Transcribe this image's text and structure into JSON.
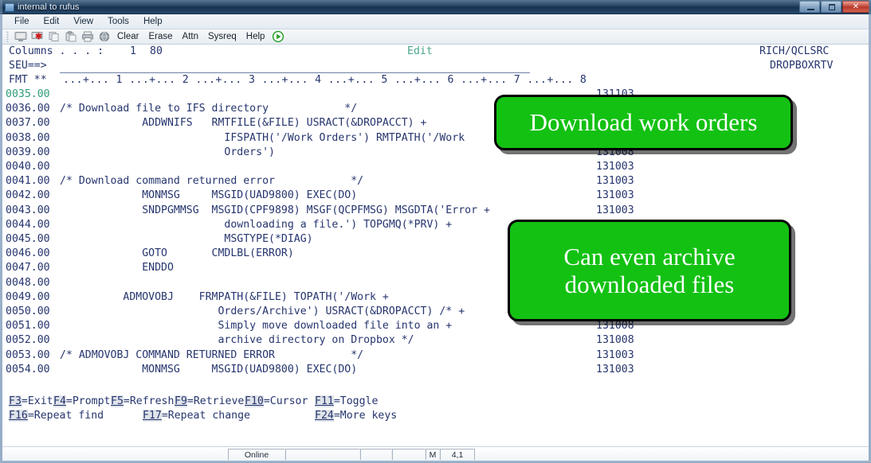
{
  "window": {
    "title": "internal to rufus",
    "buttons": {
      "minimize": "minimize-button",
      "maximize": "maximize-button",
      "close": "close-button"
    }
  },
  "menubar": {
    "items": [
      "File",
      "Edit",
      "View",
      "Tools",
      "Help"
    ]
  },
  "toolbar": {
    "icons": [
      "display-icon",
      "disconnect-icon",
      "copy-icon",
      "paste-icon",
      "print-icon",
      "macro-icon"
    ],
    "words": [
      "Clear",
      "Erase",
      "Attn",
      "Sysreq",
      "Help"
    ],
    "play": "play-icon"
  },
  "terminal": {
    "header": {
      "columns_label": "Columns . . . :",
      "columns_from": "1",
      "columns_to": "80",
      "mode": "Edit",
      "library": "RICH/QCLSRC",
      "member": "DROPBOXRTV",
      "seu_label": "SEU==>",
      "seu_value": "",
      "fmt_label": "FMT **",
      "ruler": "...+... 1 ...+... 2 ...+... 3 ...+... 4 ...+... 5 ...+... 6 ...+... 7 ...+... 8"
    },
    "lines": [
      {
        "num": "0035.00",
        "text": "",
        "date": "131103",
        "current": true
      },
      {
        "num": "0036.00",
        "text": "/* Download file to IFS directory            */",
        "date": "",
        "current": false
      },
      {
        "num": "0037.00",
        "text": "             ADDWNIFS   RMTFILE(&FILE) USRACT(&DROPACCT) +",
        "date": "",
        "current": false
      },
      {
        "num": "0038.00",
        "text": "                          IFSPATH('/Work Orders') RMTPATH('/Work",
        "date": "",
        "current": false
      },
      {
        "num": "0039.00",
        "text": "                          Orders')",
        "date": "131008",
        "current": false
      },
      {
        "num": "0040.00",
        "text": "",
        "date": "131003",
        "current": false
      },
      {
        "num": "0041.00",
        "text": "/* Download command returned error            */",
        "date": "131003",
        "current": false
      },
      {
        "num": "0042.00",
        "text": "             MONMSG     MSGID(UAD9800) EXEC(DO)",
        "date": "131003",
        "current": false
      },
      {
        "num": "0043.00",
        "text": "             SNDPGMMSG  MSGID(CPF9898) MSGF(QCPFMSG) MSGDTA('Error +",
        "date": "131003",
        "current": false
      },
      {
        "num": "0044.00",
        "text": "                          downloading a file.') TOPGMQ(*PRV) +",
        "date": "",
        "current": false
      },
      {
        "num": "0045.00",
        "text": "                          MSGTYPE(*DIAG)",
        "date": "",
        "current": false
      },
      {
        "num": "0046.00",
        "text": "             GOTO       CMDLBL(ERROR)",
        "date": "",
        "current": false
      },
      {
        "num": "0047.00",
        "text": "             ENDDO",
        "date": "",
        "current": false
      },
      {
        "num": "0048.00",
        "text": "",
        "date": "",
        "current": false
      },
      {
        "num": "0049.00",
        "text": "          ADMOVOBJ    FRMPATH(&FILE) TOPATH('/Work +",
        "date": "",
        "current": false
      },
      {
        "num": "0050.00",
        "text": "                         Orders/Archive') USRACT(&DROPACCT) /* +",
        "date": "",
        "current": false
      },
      {
        "num": "0051.00",
        "text": "                         Simply move downloaded file into an +",
        "date": "131008",
        "current": false
      },
      {
        "num": "0052.00",
        "text": "                         archive directory on Dropbox */",
        "date": "131008",
        "current": false
      },
      {
        "num": "0053.00",
        "text": "/* ADMOVOBJ COMMAND RETURNED ERROR            */",
        "date": "131003",
        "current": false
      },
      {
        "num": "0054.00",
        "text": "             MONMSG     MSGID(UAD9800) EXEC(DO)",
        "date": "131003",
        "current": false
      }
    ],
    "function_keys_row1": [
      {
        "key": "F3",
        "label": "=Exit"
      },
      {
        "key": "F4",
        "label": "=Prompt"
      },
      {
        "key": "F5",
        "label": "=Refresh"
      },
      {
        "key": "F9",
        "label": "=Retrieve"
      },
      {
        "key": "F10",
        "label": "=Cursor"
      },
      {
        "key": "F11",
        "label": "=Toggle"
      }
    ],
    "function_keys_row2": [
      {
        "key": "F16",
        "label": "=Repeat find"
      },
      {
        "key": "F17",
        "label": "=Repeat change"
      },
      {
        "key": "F24",
        "label": "=More keys"
      }
    ]
  },
  "statusbar": {
    "connection": "Online",
    "field2": "",
    "field3": "",
    "field4": "",
    "insert_mode": "M",
    "cursor_position": "4,1"
  },
  "callouts": [
    {
      "id": "callout-1",
      "text": "Download work orders"
    },
    {
      "id": "callout-2",
      "line1": "Can even archive",
      "line2": "downloaded files"
    }
  ],
  "colors": {
    "callout_fill": "#13c113",
    "terminal_text": "#26356e",
    "terminal_highlight": "#2e9c78",
    "titlebar": "#1d3c5c"
  }
}
